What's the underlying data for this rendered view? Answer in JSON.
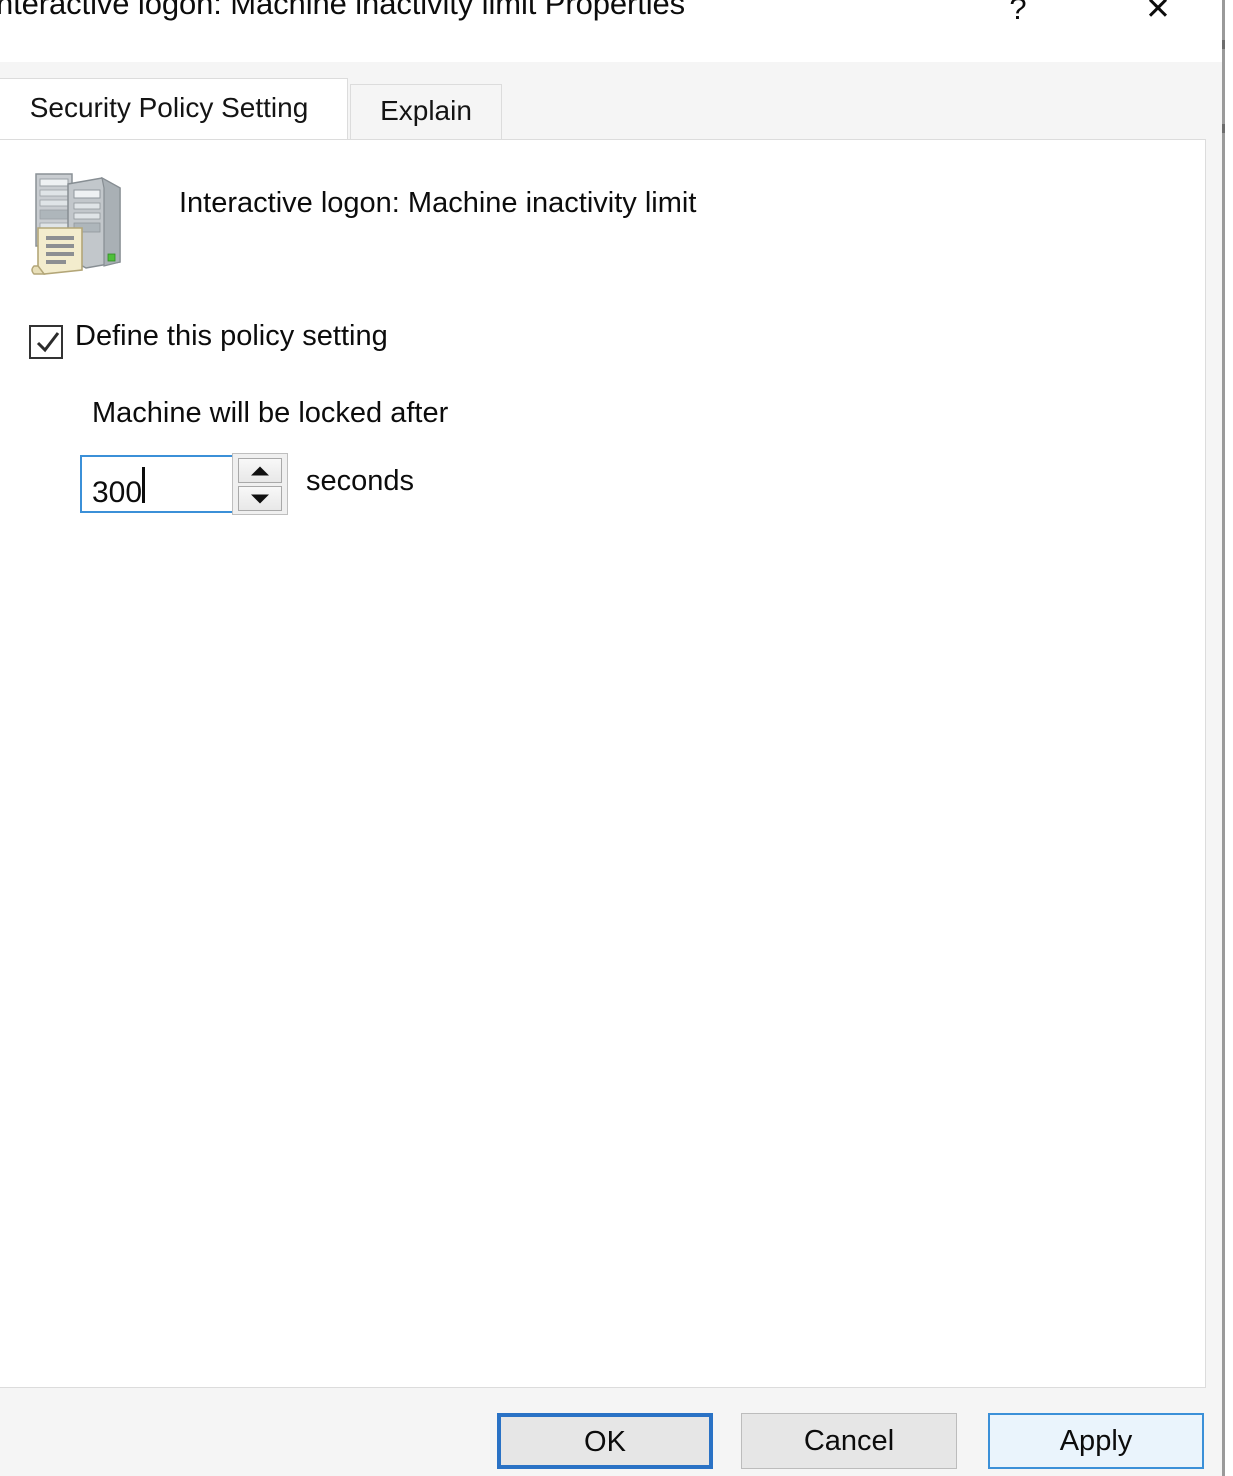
{
  "window": {
    "title": "nteractive logon: Machine inactivity limit Properties",
    "help_label": "?",
    "close_label": "✕"
  },
  "tabs": [
    {
      "label": "Security Policy Setting",
      "active": true
    },
    {
      "label": "Explain",
      "active": false
    }
  ],
  "policy": {
    "icon": "server-policy-icon",
    "name": "Interactive logon: Machine inactivity limit"
  },
  "settings": {
    "define_policy_label": "Define this policy setting",
    "define_policy_checked": true,
    "locked_after_label": "Machine will be locked after",
    "seconds_value": "300",
    "seconds_unit_label": "seconds",
    "spinner_up_label": "▲",
    "spinner_down_label": "▼"
  },
  "buttons": {
    "ok_label": "OK",
    "cancel_label": "Cancel",
    "apply_label": "Apply"
  },
  "colors": {
    "accent_blue": "#2a72c5",
    "focus_blue": "#3b90d8",
    "hover_fill": "#eaf4fc",
    "dialog_bg": "#f5f5f5",
    "panel_bg": "#ffffff",
    "button_face": "#e6e6e6"
  }
}
